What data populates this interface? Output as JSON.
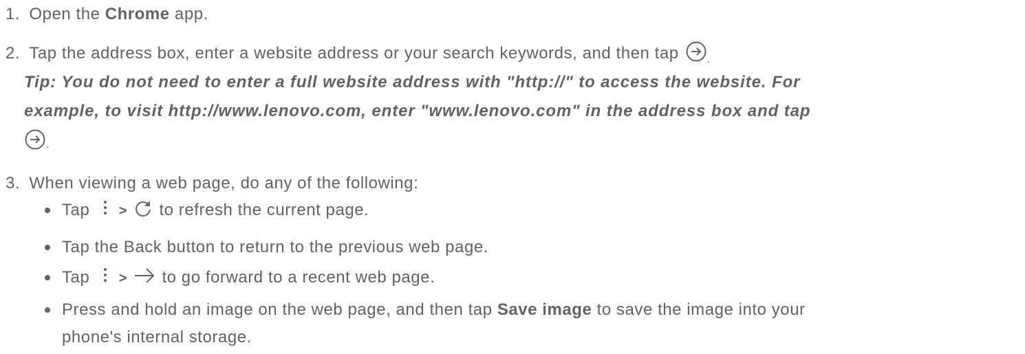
{
  "steps": [
    {
      "number": "1.",
      "pre": "Open the ",
      "bold": "Chrome",
      "post": " app."
    },
    {
      "number": "2.",
      "text": "Tap the address box, enter a website address or your search keywords, and then tap",
      "end": ".",
      "tip_lines": [
        "Tip: You do not need to enter a full website address with \"http://\" to access the website. For",
        "example, to visit http://www.lenovo.com, enter \"www.lenovo.com\" in the address box and tap"
      ],
      "tip_end": "."
    },
    {
      "number": "3.",
      "text": "When viewing a web page, do any of the following:",
      "bullets": [
        {
          "pre": "Tap",
          "sep": ">",
          "post": "to refresh the current page."
        },
        {
          "text": "Tap the Back button to return to the previous web page."
        },
        {
          "pre": "Tap",
          "sep": ">",
          "post": "to go forward to a recent web page."
        },
        {
          "pre": "Press and hold an image on the web page, and then tap ",
          "bold": "Save image",
          "post": " to save the image into your",
          "cont": "phone's internal storage."
        }
      ]
    }
  ],
  "icons": {
    "go": "circle-arrow-right-icon",
    "menu": "more-vertical-icon",
    "refresh": "refresh-icon",
    "forward": "arrow-right-icon"
  },
  "colors": {
    "text": "#5f6368"
  }
}
